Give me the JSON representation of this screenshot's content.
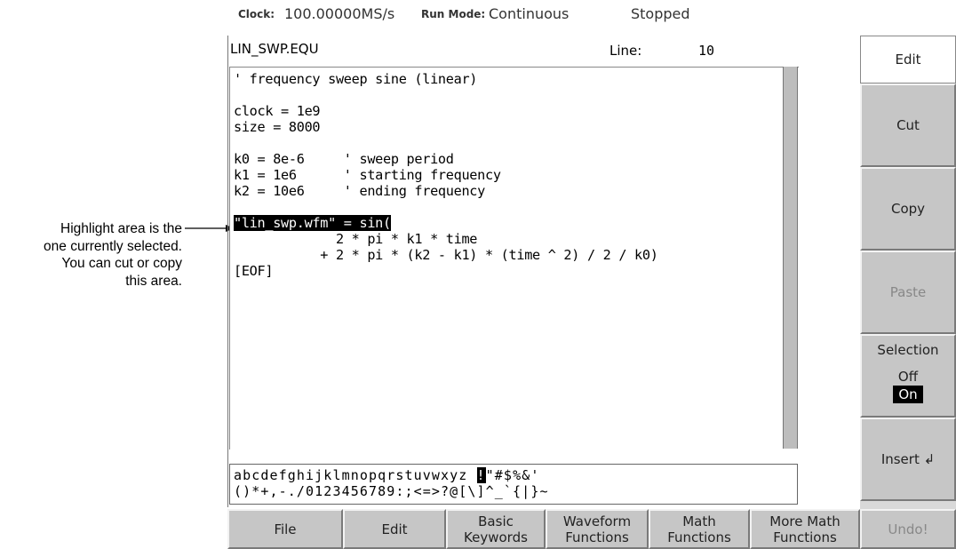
{
  "callout": {
    "lines": [
      "Highlight area is the",
      "one currently selected.",
      "You can cut or copy",
      "this area."
    ]
  },
  "status": {
    "clock_label": "Clock:",
    "clock_value": "100.00000MS/s",
    "run_mode_label": "Run Mode:",
    "run_mode_value": "Continuous",
    "state": "Stopped"
  },
  "editor": {
    "filename": "LIN_SWP.EQU",
    "line_label": "Line:",
    "line_value": "10",
    "lines": [
      "' frequency sweep sine (linear)",
      "",
      "clock = 1e9",
      "size = 8000",
      "",
      "k0 = 8e-6     ' sweep period",
      "k1 = 1e6      ' starting frequency",
      "k2 = 10e6     ' ending frequency",
      "",
      "",
      "             2 * pi * k1 * time",
      "           + 2 * pi * (k2 - k1) * (time ^ 2) / 2 / k0)",
      "[EOF]"
    ],
    "selected_text": "\"lin_swp.wfm\" = sin("
  },
  "palette": {
    "row1_before": "abcdefghijklmnopqrstuvwxyz ",
    "row1_selected": "!",
    "row1_after": "\"#$%&'",
    "row2": "()*+,-./0123456789:;<=>?@[\\]^_`{|}~"
  },
  "side_menu": {
    "edit": "Edit",
    "cut": "Cut",
    "copy": "Copy",
    "paste": "Paste",
    "selection": "Selection",
    "selection_off": "Off",
    "selection_on": "On",
    "insert": "Insert ↲"
  },
  "bottom_menu": {
    "file": "File",
    "edit": "Edit",
    "basic_1": "Basic",
    "basic_2": "Keywords",
    "waveform_1": "Waveform",
    "waveform_2": "Functions",
    "math_1": "Math",
    "math_2": "Functions",
    "more_math_1": "More Math",
    "more_math_2": "Functions",
    "undo": "Undo!"
  }
}
